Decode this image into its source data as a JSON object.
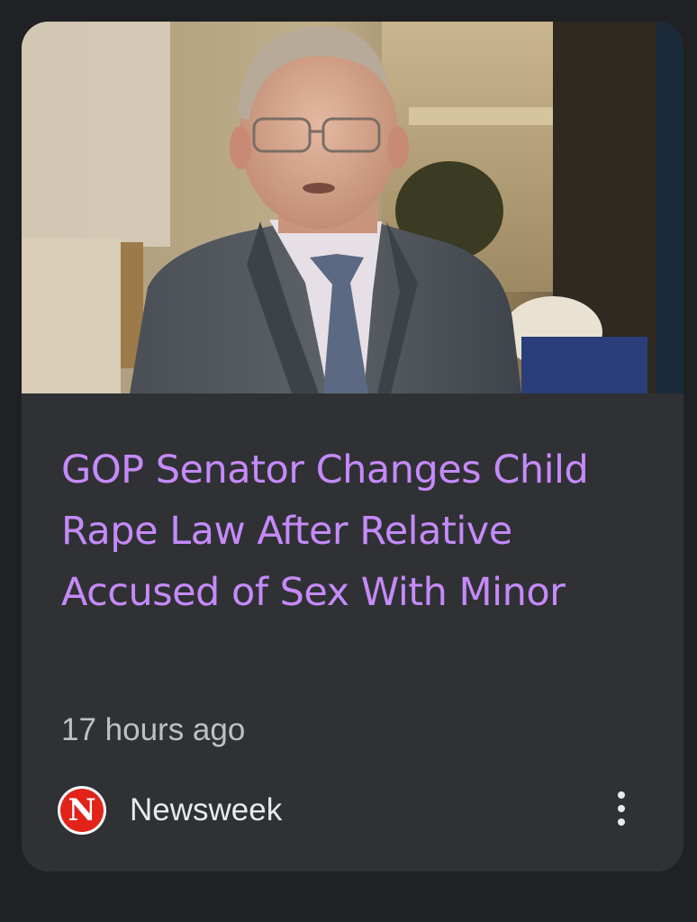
{
  "article": {
    "headline": "GOP Senator Changes Child Rape Law After Relative Accused of Sex With Minor",
    "timestamp": "17 hours ago",
    "source": {
      "name": "Newsweek",
      "logo_letter": "N",
      "logo_color": "#e2231a"
    },
    "more_icon": "more-vert-icon"
  },
  "colors": {
    "page_background": "#202124",
    "card_background": "#303134",
    "headline": "#c58af9",
    "timestamp": "#bdc1c6",
    "source_name": "#e8eaed"
  }
}
